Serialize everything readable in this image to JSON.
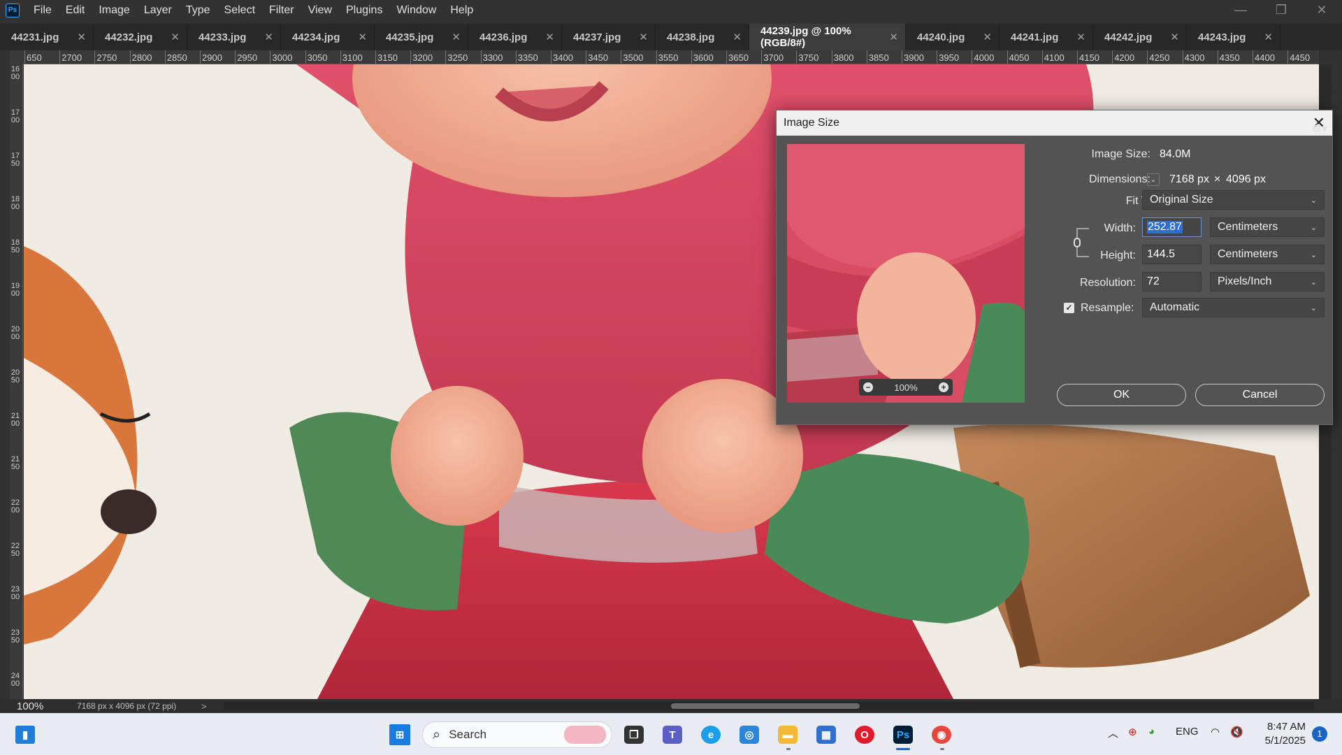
{
  "app": {
    "logo_text": "Ps"
  },
  "menu": [
    "File",
    "Edit",
    "Image",
    "Layer",
    "Type",
    "Select",
    "Filter",
    "View",
    "Plugins",
    "Window",
    "Help"
  ],
  "window_controls": {
    "minimize": "—",
    "restore": "❐",
    "close": "✕"
  },
  "tabs": [
    {
      "label": "44231.jpg",
      "active": false
    },
    {
      "label": "44232.jpg",
      "active": false
    },
    {
      "label": "44233.jpg",
      "active": false
    },
    {
      "label": "44234.jpg",
      "active": false
    },
    {
      "label": "44235.jpg",
      "active": false
    },
    {
      "label": "44236.jpg",
      "active": false
    },
    {
      "label": "44237.jpg",
      "active": false
    },
    {
      "label": "44238.jpg",
      "active": false
    },
    {
      "label": "44239.jpg @ 100% (RGB/8#)",
      "active": true
    },
    {
      "label": "44240.jpg",
      "active": false
    },
    {
      "label": "44241.jpg",
      "active": false
    },
    {
      "label": "44242.jpg",
      "active": false
    },
    {
      "label": "44243.jpg",
      "active": false
    }
  ],
  "ruler_top": [
    "650",
    "2700",
    "2750",
    "2800",
    "2850",
    "2900",
    "2950",
    "3000",
    "3050",
    "3100",
    "3150",
    "3200",
    "3250",
    "3300",
    "3350",
    "3400",
    "3450",
    "3500",
    "3550",
    "3600",
    "3650",
    "3700",
    "3750",
    "3800",
    "3850",
    "3900",
    "3950",
    "4000",
    "4050",
    "4100",
    "4150",
    "4200",
    "4250",
    "4300",
    "4350",
    "4400",
    "4450",
    "4"
  ],
  "ruler_left": [
    "1600",
    "1700",
    "1750",
    "1800",
    "1850",
    "1900",
    "2000",
    "2050",
    "2100",
    "2150",
    "2200",
    "2250",
    "2300",
    "2350",
    "2400"
  ],
  "status": {
    "zoom": "100%",
    "doc_info": "7168 px x 4096 px (72 ppi)",
    "arrow": ">"
  },
  "dialog": {
    "title": "Image Size",
    "image_size_label": "Image Size:",
    "image_size_value": "84.0M",
    "dimensions_label": "Dimensions:",
    "dim_width": "7168 px",
    "dim_x": "×",
    "dim_height": "4096 px",
    "fit_label": "Fit T...",
    "fit_value": "Original Size",
    "width_label": "Width:",
    "width_value": "252.87",
    "width_unit": "Centimeters",
    "height_label": "Height:",
    "height_value": "144.5",
    "height_unit": "Centimeters",
    "resolution_label": "Resolution:",
    "resolution_value": "72",
    "resolution_unit": "Pixels/Inch",
    "resample_label": "Resample:",
    "resample_checked": true,
    "resample_value": "Automatic",
    "preview_zoom": "100%",
    "ok_label": "OK",
    "cancel_label": "Cancel"
  },
  "taskbar": {
    "search_placeholder": "Search",
    "language": "ENG",
    "time": "8:47 AM",
    "date": "5/1/2025",
    "notification_count": "1"
  }
}
